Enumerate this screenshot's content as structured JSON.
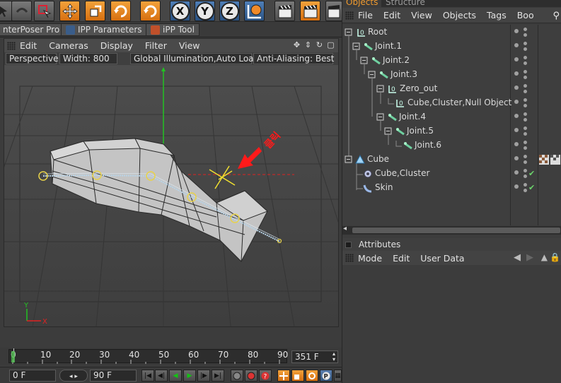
{
  "toolbar": {
    "axis_x": "X",
    "axis_y": "Y",
    "axis_z": "Z"
  },
  "plugin_tabs": [
    {
      "label": "nterPoser Pro"
    },
    {
      "label": "IPP Parameters"
    },
    {
      "label": "iPP Tool"
    }
  ],
  "viewport": {
    "menu": [
      "Edit",
      "Cameras",
      "Display",
      "Filter",
      "View"
    ],
    "camera": "Perspective",
    "width_label": "Width:",
    "width_value": "800",
    "gi_label": "Global Illumination,Auto Load",
    "aa_label": "Anti-Aliasing: Best",
    "axis_y": "Y",
    "axis_x": "X",
    "annotation": "클릭",
    "colors": {
      "axis_green": "#22c122",
      "axis_red": "#e02222",
      "annotation": "#ff1a1a",
      "joint": "#e8d24a"
    }
  },
  "timeline": {
    "ticks": [
      "0",
      "10",
      "20",
      "30",
      "40",
      "50",
      "60",
      "70",
      "80",
      "90"
    ],
    "end_frame": "351 F"
  },
  "transport": {
    "current_frame": "0 F",
    "max_frame": "90 F"
  },
  "objects_panel": {
    "tabs": [
      "Objects",
      "Structure"
    ],
    "menu": [
      "File",
      "Edit",
      "View",
      "Objects",
      "Tags",
      "Boo"
    ],
    "tree": [
      {
        "label": "Root",
        "icon": "null-icon",
        "depth": 0
      },
      {
        "label": "Joint.1",
        "icon": "joint-icon",
        "depth": 1
      },
      {
        "label": "Joint.2",
        "icon": "joint-icon",
        "depth": 2
      },
      {
        "label": "Joint.3",
        "icon": "joint-icon",
        "depth": 3
      },
      {
        "label": "Zero_out",
        "icon": "null-icon",
        "depth": 4
      },
      {
        "label": "Cube,Cluster,Null Object",
        "icon": "null-icon",
        "depth": 5
      },
      {
        "label": "Joint.4",
        "icon": "joint-icon",
        "depth": 4
      },
      {
        "label": "Joint.5",
        "icon": "joint-icon",
        "depth": 5
      },
      {
        "label": "Joint.6",
        "icon": "joint-icon",
        "depth": 6
      },
      {
        "label": "Cube",
        "icon": "cube-icon",
        "depth": 0
      },
      {
        "label": "Cube,Cluster",
        "icon": "cluster-icon",
        "depth": 1
      },
      {
        "label": "Skin",
        "icon": "skin-icon",
        "depth": 1
      }
    ]
  },
  "attributes_panel": {
    "title": "Attributes",
    "menu": [
      "Mode",
      "Edit",
      "User Data"
    ]
  }
}
